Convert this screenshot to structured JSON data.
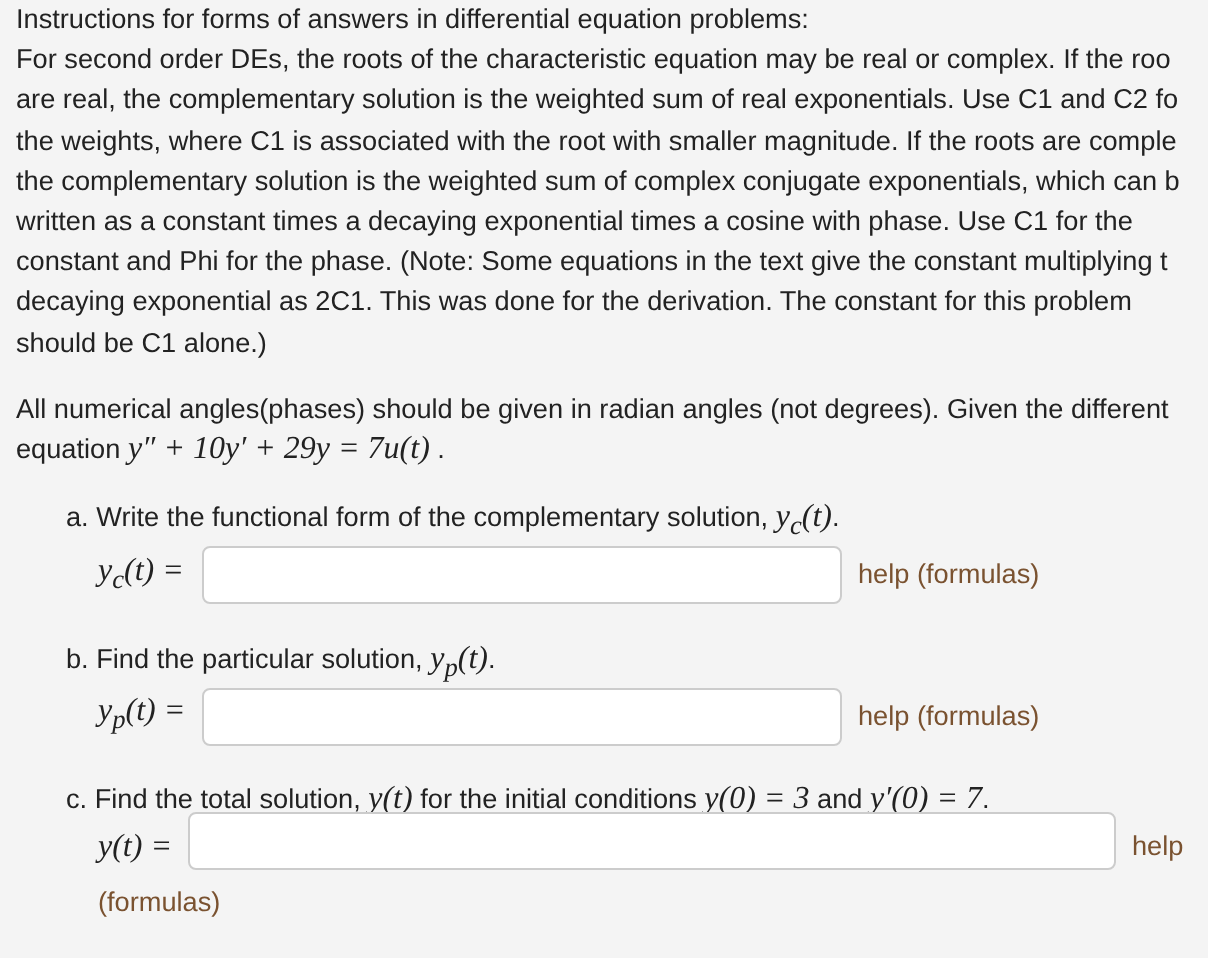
{
  "instructions": {
    "title": "Instructions for forms of answers in differential equation problems:",
    "lines": [
      "For second order DEs, the roots of the characteristic equation may be real or complex. If the roo",
      "are real, the complementary solution is the weighted sum of real exponentials. Use C1 and C2 fo",
      "the weights, where C1 is associated with the root with smaller magnitude. If the roots are comple",
      "the complementary solution is the weighted sum of complex conjugate exponentials, which can b",
      "written as a constant times a decaying exponential times a cosine with phase. Use C1 for the",
      "constant and Phi for the phase. (Note: Some equations in the text give the constant multiplying t",
      "decaying exponential as 2C1. This was done for the derivation. The constant for this problem",
      "should be C1 alone.)"
    ]
  },
  "problem": {
    "lines": [
      [
        {
          "kind": "text",
          "text": "All numerical angles(phases) should be given in radian angles (not degrees). Given the different"
        }
      ],
      [
        {
          "kind": "text",
          "text": "equation "
        },
        {
          "kind": "math",
          "text": "y″ + 10y′ + 29y = 7u(t)"
        },
        {
          "kind": "text",
          "text": " ."
        }
      ]
    ]
  },
  "parts": [
    {
      "prompt": [
        {
          "kind": "text",
          "text": "a. Write the functional form of the complementary solution, "
        },
        {
          "kind": "math",
          "text": "y$_{c}$(t)"
        },
        {
          "kind": "text",
          "text": "."
        }
      ],
      "lhs": "y$_{c}$(t) =",
      "help": [
        "help (formulas)"
      ]
    },
    {
      "prompt": [
        {
          "kind": "text",
          "text": "b. Find the particular solution, "
        },
        {
          "kind": "math",
          "text": "y$_{p}$(t)"
        },
        {
          "kind": "text",
          "text": "."
        }
      ],
      "lhs": "y$_{p}$(t) =",
      "help": [
        "help (formulas)"
      ]
    },
    {
      "prompt": [
        {
          "kind": "text",
          "text": "c. Find the total solution, "
        },
        {
          "kind": "math",
          "text": "y(t)"
        },
        {
          "kind": "text",
          "text": " for the initial conditions "
        },
        {
          "kind": "math",
          "text": "y(0) = 3"
        },
        {
          "kind": "text",
          "text": " and "
        },
        {
          "kind": "math",
          "text": "y′(0) = 7"
        },
        {
          "kind": "text",
          "text": "."
        }
      ],
      "lhs": "y(t) =",
      "help": [
        "help",
        "(formulas)"
      ]
    }
  ]
}
